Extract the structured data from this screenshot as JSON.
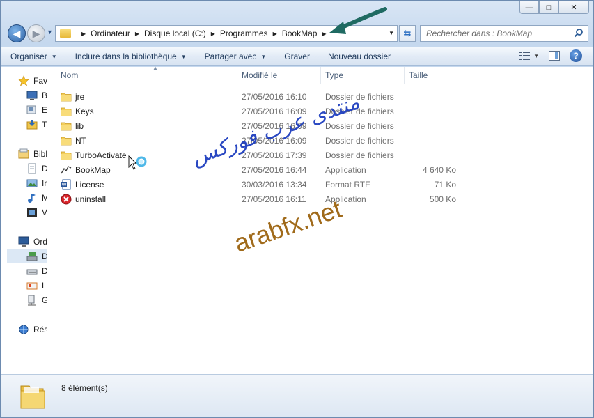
{
  "window": {
    "caption": {
      "minimize": "—",
      "maximize": "□",
      "close": "✕"
    }
  },
  "nav": {
    "back_icon": "arrow-left-icon",
    "forward_icon": "arrow-right-icon",
    "breadcrumb": [
      "Ordinateur",
      "Disque local (C:)",
      "Programmes",
      "BookMap"
    ],
    "search_placeholder": "Rechercher dans : BookMap"
  },
  "toolbar": {
    "organize": "Organiser",
    "include": "Inclure dans la bibliothèque",
    "share": "Partager avec",
    "burn": "Graver",
    "new_folder": "Nouveau dossier"
  },
  "sidebar": {
    "items": [
      {
        "label": "Favoris",
        "icon": "star-icon"
      },
      {
        "label": "Bureau",
        "icon": "desktop-icon"
      },
      {
        "label": "Emplacements récents",
        "icon": "recent-places-icon"
      },
      {
        "label": "Téléchargements",
        "icon": "downloads-icon"
      },
      {
        "label": "Bibliothèques",
        "icon": "library-icon"
      },
      {
        "label": "Documents",
        "icon": "documents-icon"
      },
      {
        "label": "Images",
        "icon": "pictures-icon"
      },
      {
        "label": "Musique",
        "icon": "music-icon"
      },
      {
        "label": "Vidéos",
        "icon": "videos-icon"
      },
      {
        "label": "Ordinateur",
        "icon": "computer-icon"
      },
      {
        "label": "Disque local (C:)",
        "icon": "local-disk-icon"
      },
      {
        "label": "DVD",
        "icon": "dvd-drive-icon"
      },
      {
        "label": "Lecteur",
        "icon": "removable-drive-icon"
      },
      {
        "label": "Gestion",
        "icon": "network-drive-icon"
      },
      {
        "label": "Réseau",
        "icon": "network-icon"
      }
    ]
  },
  "files": {
    "columns": {
      "name": "Nom",
      "modified": "Modifié le",
      "type": "Type",
      "size": "Taille"
    },
    "rows": [
      {
        "name": "jre",
        "modified": "27/05/2016 16:10",
        "type": "Dossier de fichiers",
        "size": "",
        "icon": "folder-icon"
      },
      {
        "name": "Keys",
        "modified": "27/05/2016 16:09",
        "type": "Dossier de fichiers",
        "size": "",
        "icon": "folder-icon"
      },
      {
        "name": "lib",
        "modified": "27/05/2016 16:09",
        "type": "Dossier de fichiers",
        "size": "",
        "icon": "folder-icon"
      },
      {
        "name": "NT",
        "modified": "27/05/2016 16:09",
        "type": "Dossier de fichiers",
        "size": "",
        "icon": "folder-icon"
      },
      {
        "name": "TurboActivate",
        "modified": "27/05/2016 17:39",
        "type": "Dossier de fichiers",
        "size": "",
        "icon": "folder-icon"
      },
      {
        "name": "BookMap",
        "modified": "27/05/2016 16:44",
        "type": "Application",
        "size": "4 640 Ko",
        "icon": "bookmap-app-icon"
      },
      {
        "name": "License",
        "modified": "30/03/2016 13:34",
        "type": "Format RTF",
        "size": "71 Ko",
        "icon": "word-document-icon"
      },
      {
        "name": "uninstall",
        "modified": "27/05/2016 16:11",
        "type": "Application",
        "size": "500 Ko",
        "icon": "uninstall-app-icon"
      }
    ]
  },
  "status": {
    "count": "8 élément(s)"
  },
  "watermark": {
    "arabic": "منتدى عرب فوركس",
    "url": "arabfx.net"
  },
  "colors": {
    "accent": "#2b5fa3",
    "folder": "#e7b839",
    "watermark_blue": "#1f3fbf",
    "watermark_brown": "#a06a1a"
  }
}
